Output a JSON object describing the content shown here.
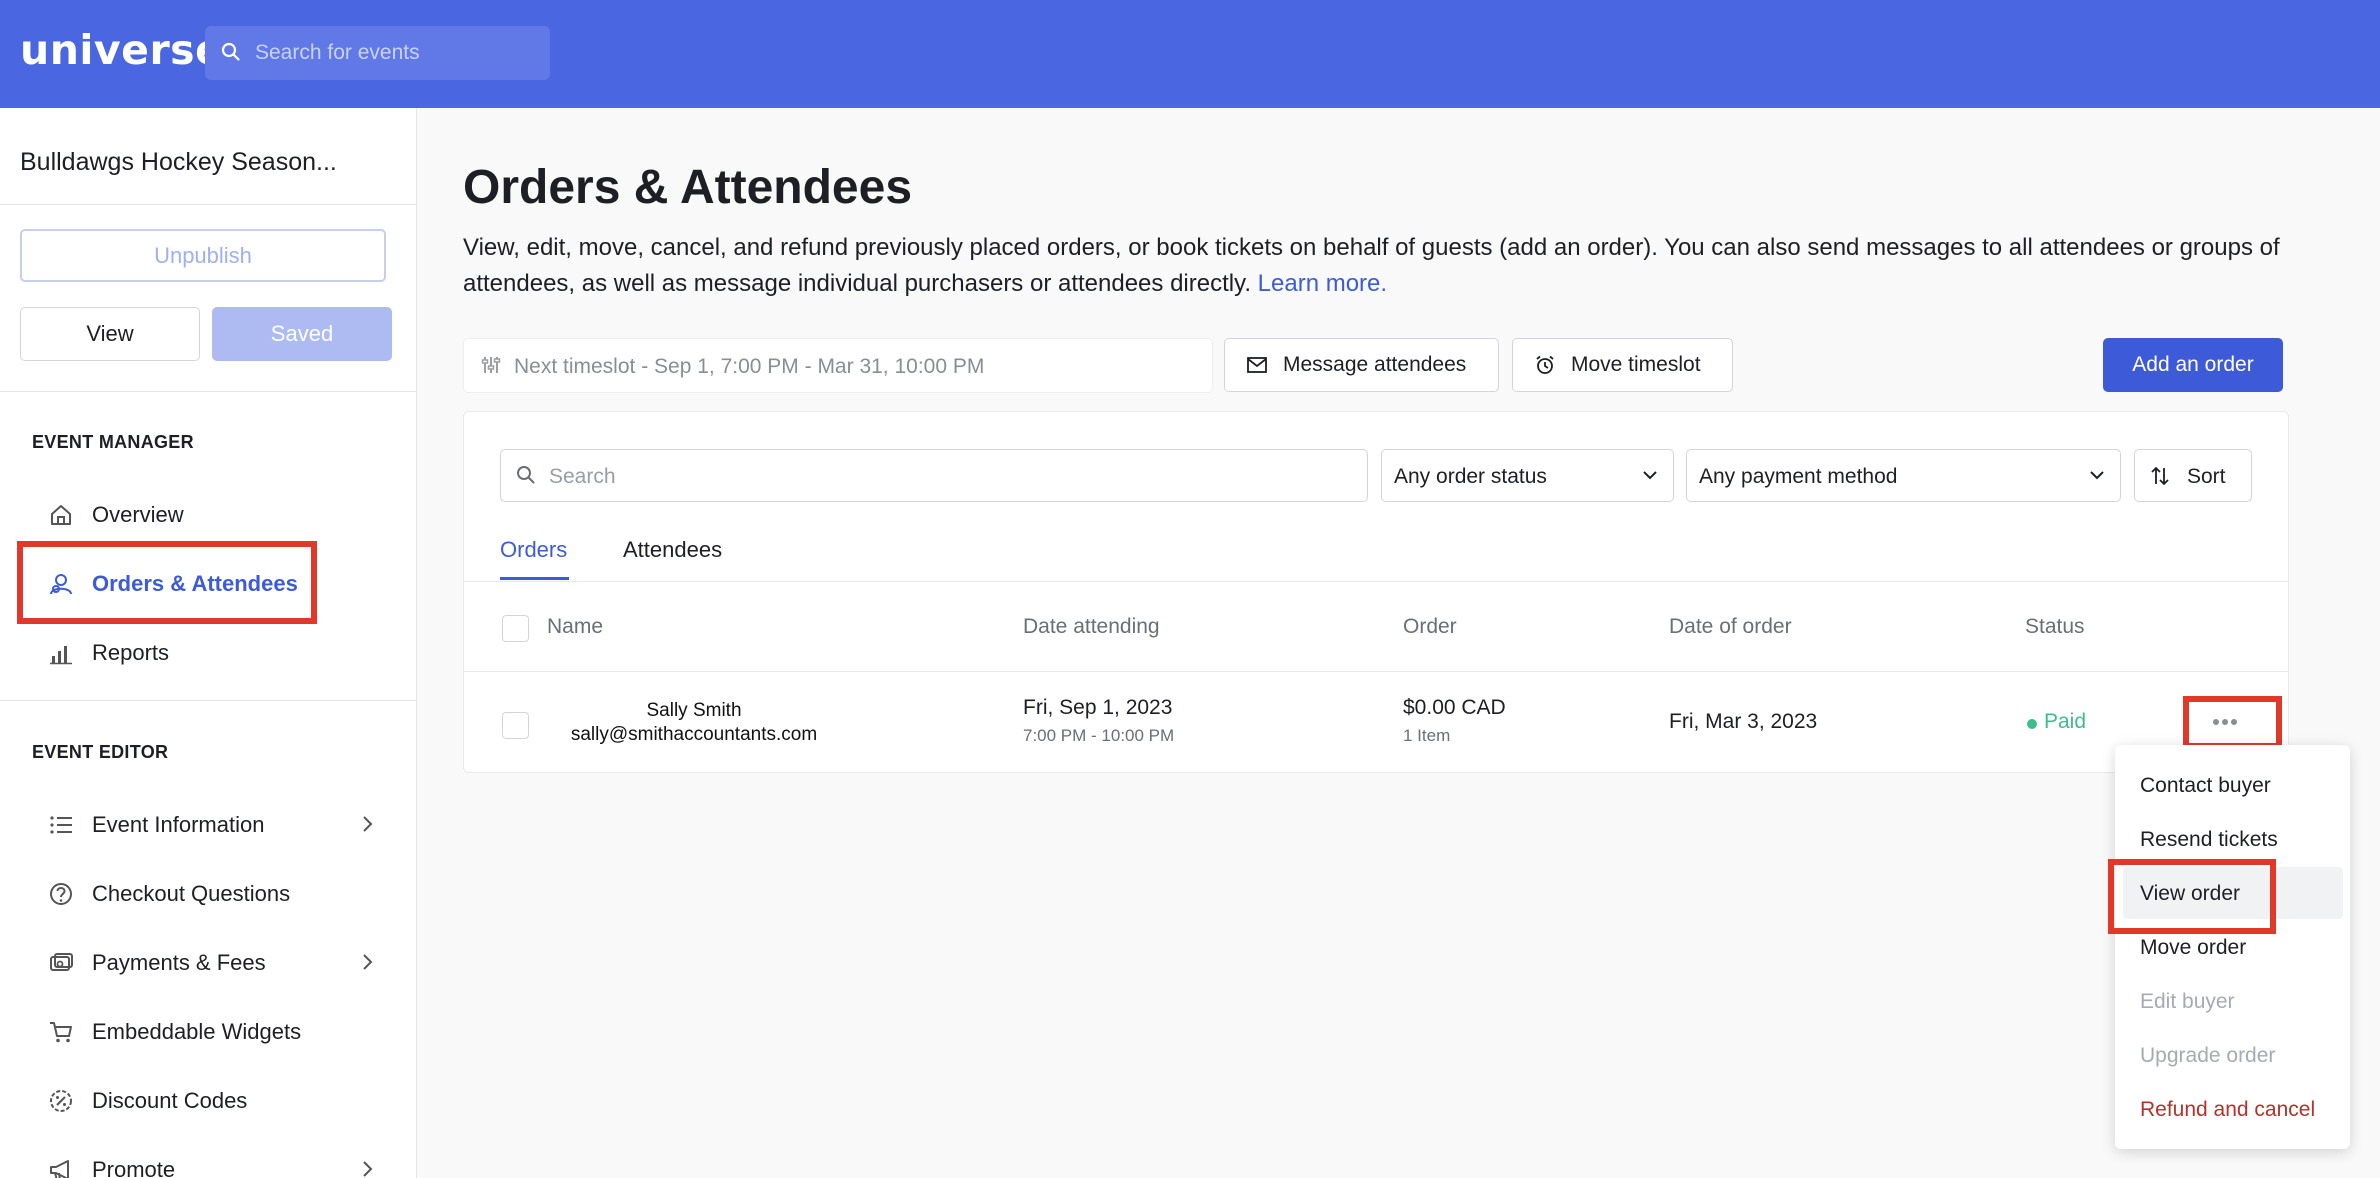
{
  "brand": {
    "logo": "universe",
    "accent": "#4a66e0"
  },
  "topbar": {
    "search_placeholder": "Search for events",
    "search_icon": "search-icon"
  },
  "sidebar": {
    "event_name": "Bulldawgs Hockey Season...",
    "unpublish_label": "Unpublish",
    "view_label": "View",
    "saved_label": "Saved",
    "event_manager_title": "EVENT MANAGER",
    "event_manager_items": [
      {
        "label": "Overview",
        "icon": "home-icon"
      },
      {
        "label": "Orders & Attendees",
        "icon": "attendees-icon",
        "active": true
      },
      {
        "label": "Reports",
        "icon": "bar-chart-icon"
      }
    ],
    "event_editor_title": "EVENT EDITOR",
    "event_editor_items": [
      {
        "label": "Event Information",
        "icon": "list-icon",
        "has_submenu": true
      },
      {
        "label": "Checkout Questions",
        "icon": "question-circle-icon"
      },
      {
        "label": "Payments & Fees",
        "icon": "payments-icon",
        "has_submenu": true
      },
      {
        "label": "Embeddable Widgets",
        "icon": "cart-icon"
      },
      {
        "label": "Discount Codes",
        "icon": "discount-icon"
      },
      {
        "label": "Promote",
        "icon": "megaphone-icon",
        "has_submenu": true
      }
    ]
  },
  "main": {
    "title": "Orders & Attendees",
    "description": "View, edit, move, cancel, and refund previously placed orders, or book tickets on behalf of guests (add an order). You can also send messages to all attendees or groups of attendees, as well as message individual purchasers or attendees directly.",
    "learn_more": "Learn more.",
    "timeslot": "Next timeslot - Sep 1, 7:00 PM - Mar 31, 10:00 PM",
    "message_attendees": "Message attendees",
    "move_timeslot": "Move timeslot",
    "add_order": "Add an order"
  },
  "filters": {
    "search_placeholder": "Search",
    "order_status": "Any order status",
    "payment_method": "Any payment method",
    "sort": "Sort"
  },
  "tabs": [
    {
      "label": "Orders",
      "active": true
    },
    {
      "label": "Attendees",
      "active": false
    }
  ],
  "table": {
    "headers": [
      "Name",
      "Date attending",
      "Order",
      "Date of order",
      "Status"
    ],
    "rows": [
      {
        "name": "Sally Smith",
        "email": "sally@smithaccountants.com",
        "date_attending": "Fri, Sep 1, 2023",
        "time_attending": "7:00 PM - 10:00 PM",
        "order_total": "$0.00 CAD",
        "order_items": "1 Item",
        "date_of_order": "Fri, Mar 3, 2023",
        "status": "Paid"
      }
    ]
  },
  "row_menu": {
    "items": [
      {
        "label": "Contact buyer",
        "state": "enabled"
      },
      {
        "label": "Resend tickets",
        "state": "enabled"
      },
      {
        "label": "View order",
        "state": "hover"
      },
      {
        "label": "Move order",
        "state": "enabled"
      },
      {
        "label": "Edit buyer",
        "state": "disabled"
      },
      {
        "label": "Upgrade order",
        "state": "disabled"
      },
      {
        "label": "Refund and cancel",
        "state": "danger"
      }
    ]
  },
  "colors": {
    "highlight": "#e0392a",
    "status_paid": "#3dbd8c",
    "danger": "#b3322a",
    "primary": "#3d5bd9"
  }
}
